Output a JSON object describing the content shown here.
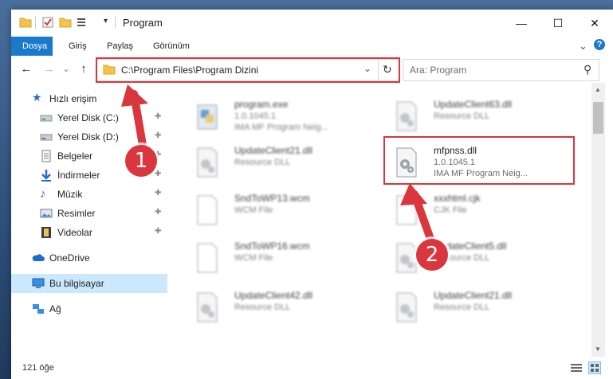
{
  "title_bar": {
    "title": "Program",
    "minimize_icon": "minimize-icon",
    "maximize_icon": "maximize-icon",
    "close_icon": "close-icon",
    "minimize_glyph": "—",
    "maximize_glyph": "☐",
    "close_glyph": "✕"
  },
  "ribbon": {
    "tabs": [
      "Dosya",
      "Giriş",
      "Paylaş",
      "Görünüm"
    ],
    "expand_glyph": "⌄",
    "help_glyph": "?"
  },
  "nav": {
    "back_glyph": "←",
    "forward_glyph": "→",
    "recent_glyph": "⌄",
    "up_glyph": "↑",
    "address": "C:\\Program Files\\Program Dizini",
    "address_dropdown_glyph": "⌄",
    "refresh_glyph": "↻",
    "search_placeholder": "Ara: Program",
    "search_glyph": "⚲"
  },
  "sidebar": {
    "quick_access": "Hızlı erişim",
    "items": [
      {
        "label": "Yerel Disk (C:)",
        "icon": "drive-icon",
        "pinned": true
      },
      {
        "label": "Yerel Disk (D:)",
        "icon": "drive-icon",
        "pinned": true
      },
      {
        "label": "Belgeler",
        "icon": "documents-icon",
        "pinned": true
      },
      {
        "label": "İndirmeler",
        "icon": "downloads-icon",
        "pinned": true
      },
      {
        "label": "Müzik",
        "icon": "music-icon",
        "pinned": true
      },
      {
        "label": "Resimler",
        "icon": "pictures-icon",
        "pinned": true
      },
      {
        "label": "Videolar",
        "icon": "videos-icon",
        "pinned": true
      }
    ],
    "pin_glyph": "📌",
    "onedrive": "OneDrive",
    "this_pc": "Bu bilgisayar",
    "network": "Ağ"
  },
  "files": [
    {
      "name": "program.exe",
      "line2": "1.0.1045.1",
      "line3": "IMA MF Program Neig...",
      "icon": "exe-icon",
      "highlighted": false
    },
    {
      "name": "UpdateClient63.dll",
      "line2": "Resource DLL",
      "line3": "",
      "icon": "dll-icon",
      "highlighted": false
    },
    {
      "name": "UpdateClient21.dll",
      "line2": "Resource DLL",
      "line3": "",
      "icon": "dll-icon",
      "highlighted": false
    },
    {
      "name": "mfpnss.dll",
      "line2": "1.0.1045.1",
      "line3": "IMA MF Program Neig...",
      "icon": "dll-icon",
      "highlighted": true
    },
    {
      "name": "SndToWP13.wcm",
      "line2": "WCM File",
      "line3": "",
      "icon": "file-icon",
      "highlighted": false
    },
    {
      "name": "xxxhtml.cjk",
      "line2": "CJK File",
      "line3": "",
      "icon": "file-icon",
      "highlighted": false
    },
    {
      "name": "SndToWP16.wcm",
      "line2": "WCM File",
      "line3": "",
      "icon": "file-icon",
      "highlighted": false
    },
    {
      "name": "UpdateClient5.dll",
      "line2": "Resource DLL",
      "line3": "",
      "icon": "dll-icon",
      "highlighted": false
    },
    {
      "name": "UpdateClient42.dll",
      "line2": "Resource DLL",
      "line3": "",
      "icon": "dll-icon",
      "highlighted": false
    },
    {
      "name": "UpdateClient21.dll",
      "line2": "Resource DLL",
      "line3": "",
      "icon": "dll-icon",
      "highlighted": false
    }
  ],
  "status": {
    "count": "121 öğe"
  },
  "annotations": {
    "step1": "1",
    "step2": "2",
    "color": "#d9363e"
  }
}
